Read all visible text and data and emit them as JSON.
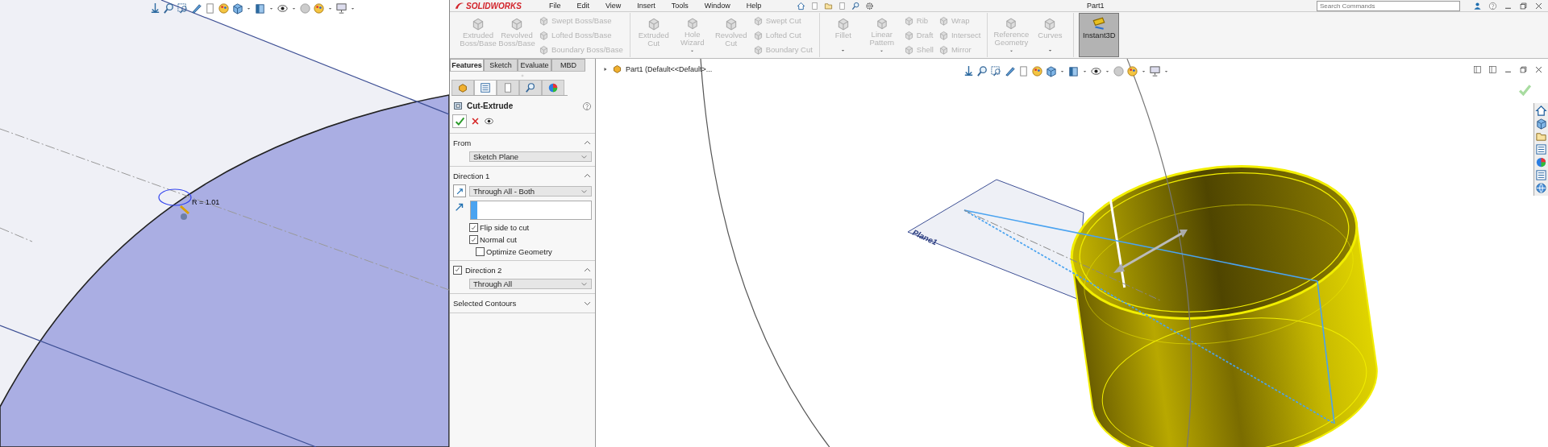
{
  "app": {
    "logo_text": "SOLIDWORKS",
    "menus": [
      "File",
      "Edit",
      "View",
      "Insert",
      "Tools",
      "Window",
      "Help"
    ],
    "document_title": "Part1",
    "search": {
      "placeholder": "Search Commands"
    }
  },
  "ribbon": {
    "groups": [
      {
        "items": [
          {
            "kind": "large",
            "label": "Extruded Boss/Base",
            "disabled": true,
            "selected": false,
            "has_menu": false
          },
          {
            "kind": "large",
            "label": "Revolved Boss/Base",
            "disabled": true,
            "selected": false,
            "has_menu": false
          },
          {
            "kind": "small",
            "label": "Swept Boss/Base",
            "disabled": true,
            "selected": false
          },
          {
            "kind": "small",
            "label": "Lofted Boss/Base",
            "disabled": true,
            "selected": false
          },
          {
            "kind": "small",
            "label": "Boundary Boss/Base",
            "disabled": true,
            "selected": false
          }
        ]
      },
      {
        "items": [
          {
            "kind": "large",
            "label": "Extruded Cut",
            "disabled": true,
            "selected": false,
            "has_menu": false
          },
          {
            "kind": "large",
            "label": "Hole Wizard",
            "disabled": true,
            "selected": false,
            "has_menu": true
          },
          {
            "kind": "large",
            "label": "Revolved Cut",
            "disabled": true,
            "selected": false,
            "has_menu": false
          },
          {
            "kind": "small",
            "label": "Swept Cut",
            "disabled": true,
            "selected": false
          },
          {
            "kind": "small",
            "label": "Lofted Cut",
            "disabled": true,
            "selected": false
          },
          {
            "kind": "small",
            "label": "Boundary Cut",
            "disabled": true,
            "selected": false
          }
        ]
      },
      {
        "items": [
          {
            "kind": "large",
            "label": "Fillet",
            "disabled": true,
            "selected": false,
            "has_menu": true
          },
          {
            "kind": "large",
            "label": "Linear Pattern",
            "disabled": true,
            "selected": false,
            "has_menu": true
          },
          {
            "kind": "small",
            "label": "Rib",
            "disabled": true,
            "selected": false
          },
          {
            "kind": "small",
            "label": "Draft",
            "disabled": true,
            "selected": false
          },
          {
            "kind": "small",
            "label": "Shell",
            "disabled": true,
            "selected": false
          },
          {
            "kind": "small",
            "label": "Wrap",
            "disabled": true,
            "selected": false
          },
          {
            "kind": "small",
            "label": "Intersect",
            "disabled": true,
            "selected": false
          },
          {
            "kind": "small",
            "label": "Mirror",
            "disabled": true,
            "selected": false
          }
        ]
      },
      {
        "items": [
          {
            "kind": "large",
            "label": "Reference Geometry",
            "disabled": true,
            "selected": false,
            "has_menu": true
          },
          {
            "kind": "large",
            "label": "Curves",
            "disabled": true,
            "selected": false,
            "has_menu": true
          }
        ]
      },
      {
        "items": [
          {
            "kind": "large",
            "label": "Instant3D",
            "disabled": false,
            "selected": true,
            "has_menu": false
          }
        ]
      }
    ]
  },
  "command_tabs": [
    {
      "label": "Features",
      "selected": true
    },
    {
      "label": "Sketch",
      "selected": false
    },
    {
      "label": "Evaluate",
      "selected": false
    },
    {
      "label": "MBD",
      "selected": false
    }
  ],
  "property_manager": {
    "panel_tabs": [
      {
        "selected": false
      },
      {
        "selected": true
      },
      {
        "selected": false
      },
      {
        "selected": false
      },
      {
        "selected": false
      }
    ],
    "title": "Cut-Extrude",
    "sections": [
      {
        "kind": "plain",
        "title": "From",
        "expanded": true,
        "fields": [
          {
            "kind": "dropdown",
            "value": "Sketch Plane"
          }
        ]
      },
      {
        "kind": "plain",
        "title": "Direction 1",
        "expanded": true,
        "fields": [
          {
            "kind": "dropdown",
            "value": "Through All - Both",
            "reverse_button": true
          },
          {
            "kind": "selection"
          },
          {
            "kind": "checkbox",
            "label": "Flip side to cut",
            "checked": true,
            "indented": false
          },
          {
            "kind": "checkbox",
            "label": "Normal cut",
            "checked": true,
            "indented": false
          },
          {
            "kind": "checkbox",
            "label": "Optimize Geometry",
            "checked": false,
            "indented": true
          }
        ]
      },
      {
        "kind": "checkable",
        "title": "Direction 2",
        "checked": true,
        "expanded": true,
        "fields": [
          {
            "kind": "dropdown",
            "value": "Through All"
          }
        ]
      },
      {
        "kind": "plain",
        "title": "Selected Contours",
        "expanded": false
      }
    ]
  },
  "feature_tree": {
    "items": [
      {
        "label": "Part1  (Default<<Default>...",
        "expanded": false
      }
    ]
  },
  "sketch_view": {
    "dimension_label": "R = 1.01"
  },
  "model_view": {
    "plane_label": "Plane1"
  }
}
